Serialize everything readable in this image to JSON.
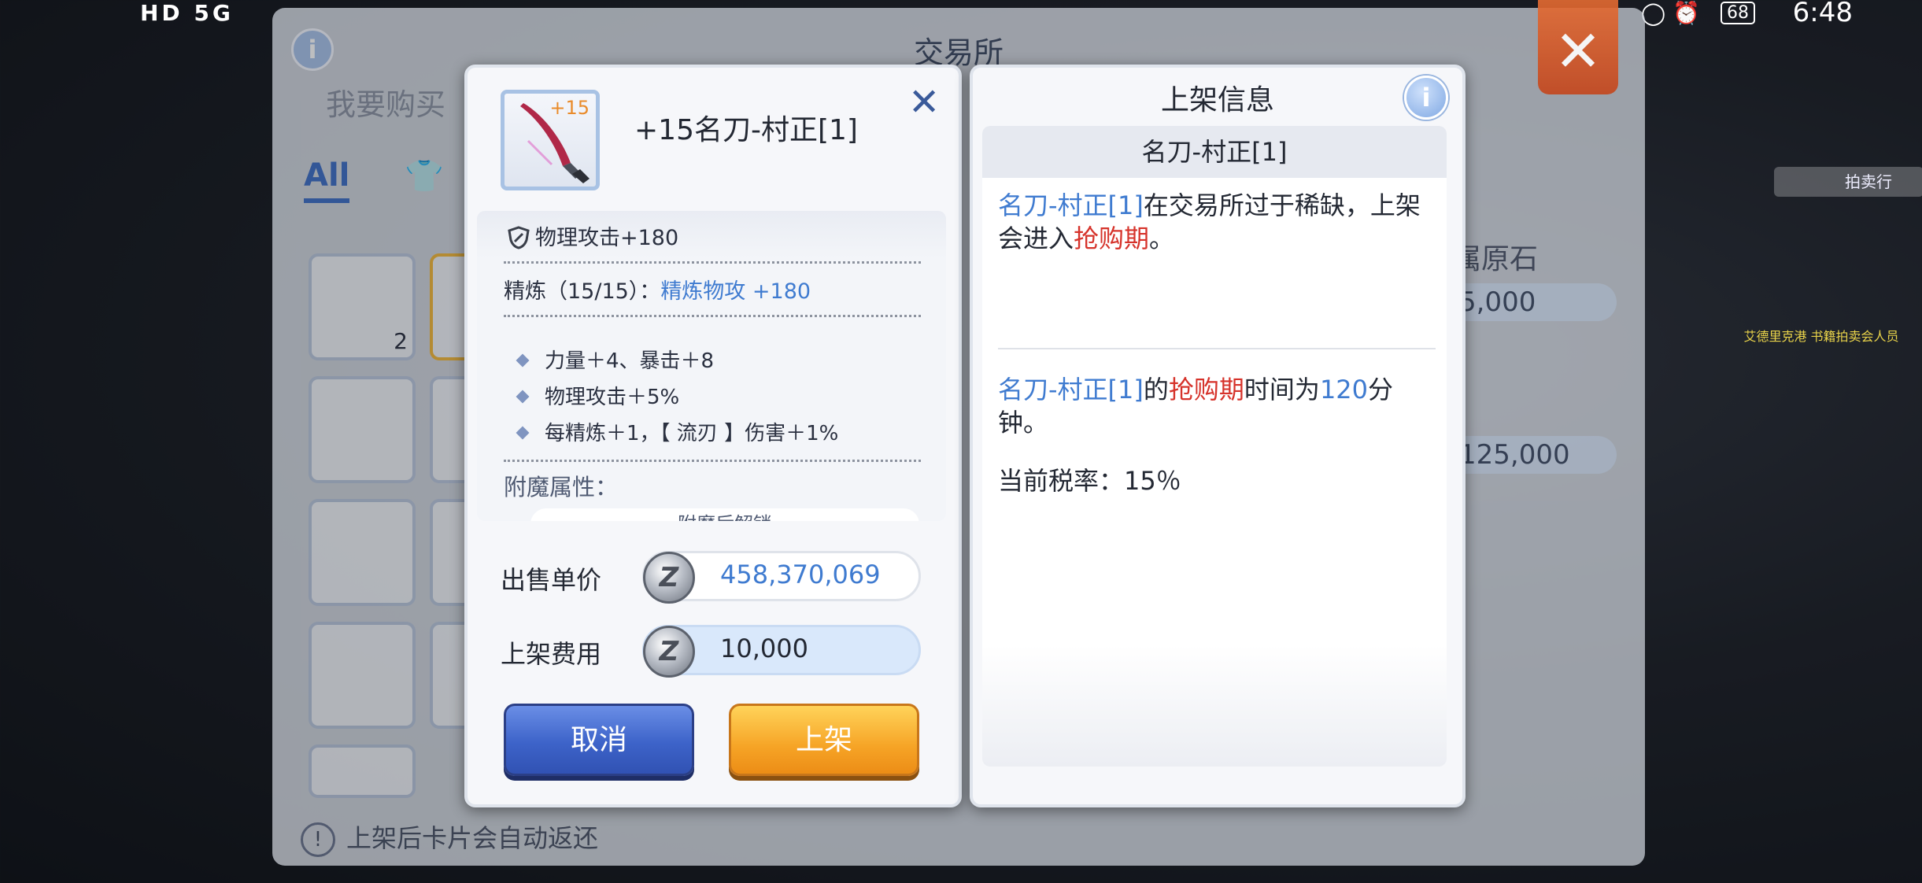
{
  "status_bar": {
    "left_text": "HD 5G",
    "battery": "68",
    "time": "6:48"
  },
  "exchange": {
    "title": "交易所",
    "info_icon": "i",
    "buy_label": "我要购买",
    "tab_all": "All",
    "grid_badge": "2",
    "right_items": [
      {
        "name": "属原石",
        "price": "5,000"
      },
      {
        "name": "",
        "price": "125,000"
      }
    ],
    "side_tag": "拍卖行",
    "side_notice": "艾德里克港 书籍拍卖会人员",
    "footer_notice": "上架后卡片会自动返还"
  },
  "item": {
    "refine_badge": "+15",
    "name": "+15名刀-村正[1]",
    "main_stat": "物理攻击+180",
    "refine_label": "精炼（15/15）：",
    "refine_value": "精炼物攻 +180",
    "bullets": [
      "力量＋4、暴击＋8",
      "物理攻击＋5%",
      "每精炼＋1，【 流刃 】伤害＋1%"
    ],
    "enchant_label": "附魔属性：",
    "enchant_button": "附魔后解锁",
    "sell_price_label": "出售单价",
    "sell_price": "458,370,069",
    "listing_fee_label": "上架费用",
    "listing_fee": "10,000",
    "coin_symbol": "Z",
    "cancel_button": "取消",
    "list_button": "上架",
    "close_icon": "✕"
  },
  "listing_info": {
    "title": "上架信息",
    "info_icon": "i",
    "item_name": "名刀-村正[1]",
    "p1_item": "名刀-村正[1]",
    "p1_text_a": "在交易所过于稀缺，上架会进入",
    "p1_highlight": "抢购期",
    "p1_text_b": "。",
    "p2_item": "名刀-村正[1]",
    "p2_text_a": "的",
    "p2_highlight": "抢购期",
    "p2_text_b": "时间为",
    "p2_minutes": "120",
    "p2_text_c": "分钟。",
    "tax_rate": "当前税率：15％"
  }
}
